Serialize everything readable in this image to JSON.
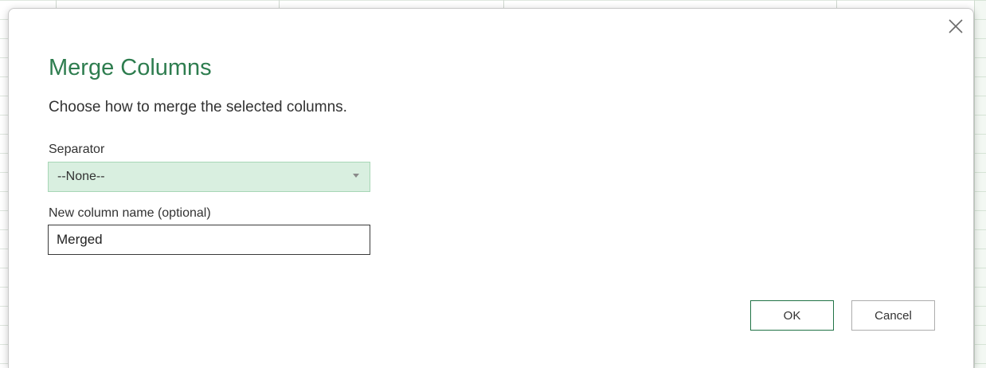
{
  "dialog": {
    "title": "Merge Columns",
    "subtitle": "Choose how to merge the selected columns.",
    "close_icon": "close-icon",
    "separator": {
      "label": "Separator",
      "selected": "--None--",
      "icon": "chevron-down-icon"
    },
    "new_column": {
      "label": "New column name (optional)",
      "value": "Merged"
    },
    "buttons": {
      "ok": "OK",
      "cancel": "Cancel"
    }
  },
  "colors": {
    "title": "#2e7d4f",
    "select_bg": "#d9efe0",
    "ok_border": "#217346"
  }
}
